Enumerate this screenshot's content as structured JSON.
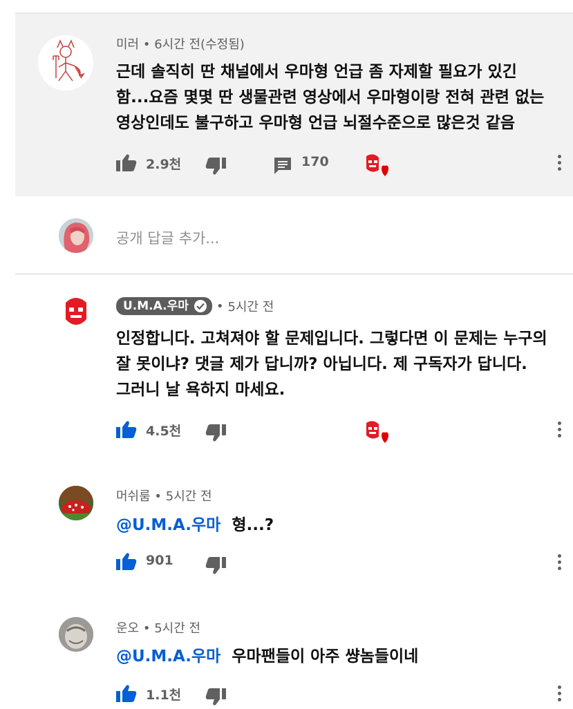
{
  "comment": {
    "author": "미러",
    "time": "6시간 전(수정됨)",
    "text_lines": [
      "근데 솔직히 딴 채널에서 우마형 언급 좀 자제할 필요가 있긴",
      "함...요즘 몇몇 딴 생물관련 영상에서 우마형이랑 전혀 관련 없는",
      "영상인데도 불구하고 우마형 언급 뇌절수준으로 많은것 같음"
    ],
    "likes": "2.9천",
    "replies": "170"
  },
  "reply_box": {
    "placeholder": "공개 답글 추가..."
  },
  "replies": [
    {
      "author": "U.M.A.우마",
      "time": "5시간 전",
      "text_lines": [
        "인정합니다. 고쳐져야 할 문제입니다. 그렇다면 이 문제는 누구의",
        "잘 못이냐? 댓글 제가 답니까? 아닙니다. 제 구독자가 답니다.",
        "그러니 날 욕하지 마세요."
      ],
      "likes": "4.5천"
    },
    {
      "author": "머쉬룸",
      "time": "5시간 전",
      "mention": "@U.M.A.우마",
      "text": "형...?",
      "likes": "901"
    },
    {
      "author": "운오",
      "time": "5시간 전",
      "mention": "@U.M.A.우마",
      "text": "우마팬들이 아주 썅놈들이네",
      "likes": "1.1천"
    }
  ],
  "colors": {
    "accent_blue": "#065fd4",
    "card_bg": "#f2f2f2",
    "icon_gray": "#606060",
    "heart_red": "#e00000"
  }
}
